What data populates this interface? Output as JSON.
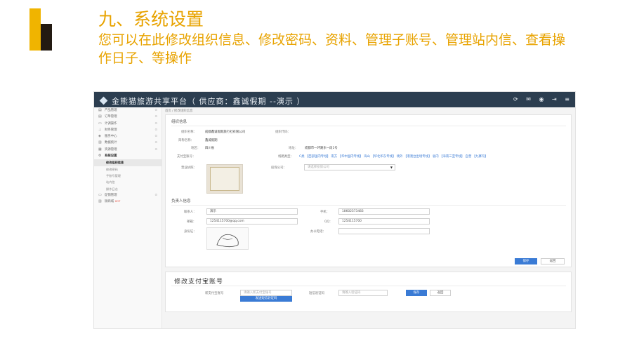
{
  "slide": {
    "title": "九、系统设置",
    "subtitle": "您可以在此修改组织信息、修改密码、资料、管理子账号、管理站内信、查看操作日子、等操作",
    "accent": "#e8a300"
  },
  "app": {
    "brand": "金熊猫旅游共享平台（ 供应商：鑫诚假期 --演示 ）",
    "topbar_tools": [
      "⟳",
      "✉",
      "◉",
      "⇥",
      "≡"
    ],
    "topbar_color": "#2c3e50",
    "breadcrumb": "首页 / 修改组织信息",
    "sidebar": [
      {
        "icon": "grid-icon",
        "glyph": "▤",
        "label": "产品管理"
      },
      {
        "icon": "list-icon",
        "glyph": "▤",
        "label": "订单管理"
      },
      {
        "icon": "card-icon",
        "glyph": "▭",
        "label": "计调操作"
      },
      {
        "icon": "chart-icon",
        "glyph": "⊥",
        "label": "财务管理"
      },
      {
        "icon": "tag-icon",
        "glyph": "◈",
        "label": "服务中心"
      },
      {
        "icon": "stats-icon",
        "glyph": "▥",
        "label": "数据统计"
      },
      {
        "icon": "folder-icon",
        "glyph": "▦",
        "label": "资源管理"
      },
      {
        "icon": "gear-icon",
        "glyph": "⚙",
        "label": "系统设置",
        "active": true
      }
    ],
    "sidebar_sub": [
      {
        "label": "修改组织信息",
        "active": true
      },
      {
        "label": "修改密码"
      },
      {
        "label": "子账号管理"
      },
      {
        "label": "站内信"
      },
      {
        "label": "操作日志"
      }
    ],
    "sidebar_after": [
      {
        "icon": "monitor-icon",
        "glyph": "▭",
        "label": "促销管理"
      },
      {
        "icon": "store-icon",
        "glyph": "▥",
        "label": "微商城",
        "badge": "HOT"
      }
    ],
    "org": {
      "section_title": "组织信息",
      "name_label": "组织名称：",
      "name_value": "成都鑫诚假期旅行社有限公司",
      "code_label": "组织代码：",
      "code_value": "",
      "abbr_label": "简称名称：",
      "abbr_value": "鑫诚假期",
      "region_label": "地区：",
      "region_value": "四川省",
      "address_label": "地址：",
      "address_value": "成都市一环路东一段1号",
      "account_label": "支付宝账号：",
      "route_label": "线路类型：",
      "route_value": "C类 【西部国内专线】 南方 【华中国内专线】 海山 【华北华东专线】 境外 【港澳台出境专线】 省内 【海南三亚专线】 自营 【九寨沟】",
      "license_label": "营业执照：",
      "insurance_label": "投保公司：",
      "insurance_placeholder": "请选择投保公司"
    },
    "contact": {
      "section_title": "负责人信息",
      "person_label": "联系人：",
      "person_value": "演示",
      "mobile_label": "手机：",
      "mobile_value": "18602573483",
      "email_label": "邮箱：",
      "email_value": "1254115700@qq.com",
      "qq_label": "QQ：",
      "qq_value": "1254115700",
      "id_label": "身份证：",
      "phone_label": "办公电话：",
      "phone_value": ""
    },
    "form_buttons": {
      "save": "保存",
      "back": "返回"
    },
    "alipay": {
      "section_title": "修改支付宝账号",
      "new_label": "新支付宝账号",
      "new_placeholder": "请输入新支付宝账号",
      "code_label": "短信验证码",
      "code_placeholder": "请输入验证码",
      "send_code": "发送短信验证码",
      "save": "保存",
      "back": "返回"
    }
  }
}
